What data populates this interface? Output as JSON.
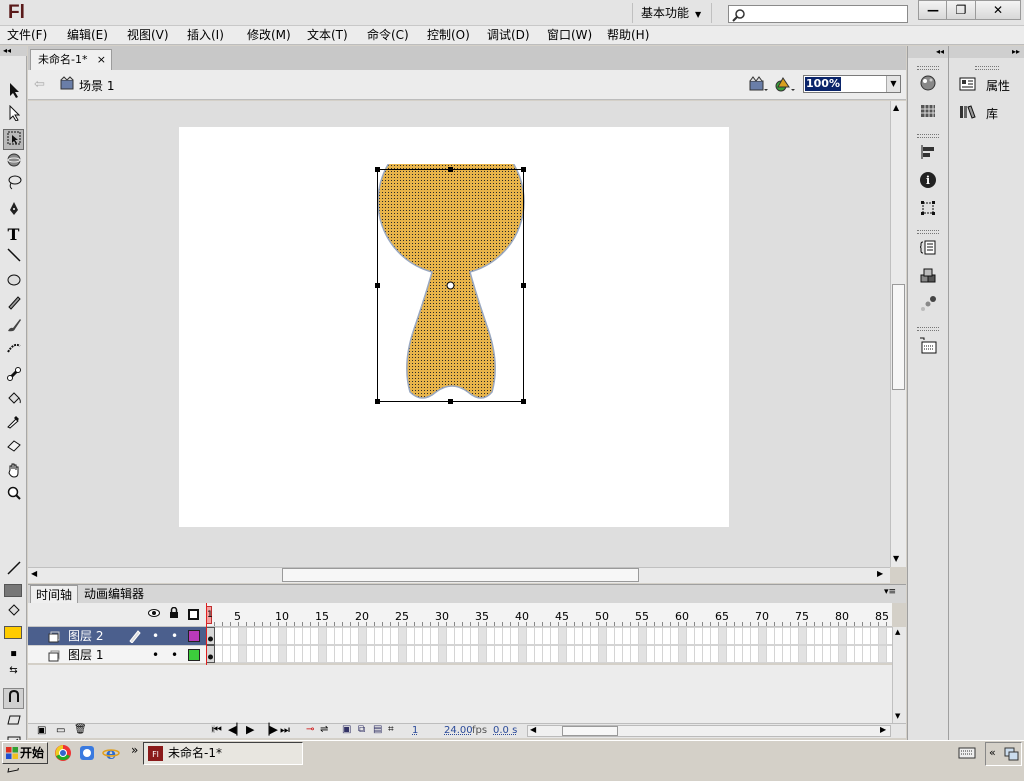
{
  "app": {
    "logo": "Fl",
    "workspace": "基本功能"
  },
  "window_controls": {
    "minimize": "—",
    "restore": "❐",
    "close": "✕"
  },
  "menubar": [
    "文件(F)",
    "编辑(E)",
    "视图(V)",
    "插入(I)",
    "修改(M)",
    "文本(T)",
    "命令(C)",
    "控制(O)",
    "调试(D)",
    "窗口(W)",
    "帮助(H)"
  ],
  "document": {
    "tab": "未命名-1*",
    "scene": "场景 1",
    "zoom": "100%"
  },
  "timeline": {
    "tabs": [
      "时间轴",
      "动画编辑器"
    ],
    "frame_numbers": [
      "1",
      "5",
      "10",
      "15",
      "20",
      "25",
      "30",
      "35",
      "40",
      "45",
      "50",
      "55",
      "60",
      "65",
      "70",
      "75",
      "80",
      "85"
    ],
    "layers": [
      {
        "name": "图层 2",
        "selected": true,
        "color": "#b93ab9"
      },
      {
        "name": "图层 1",
        "selected": false,
        "color": "#3ccc3c"
      }
    ],
    "status": {
      "current_frame": "1",
      "fps": "24.00",
      "fps_unit": "fps",
      "time": "0.0 s"
    }
  },
  "panels": {
    "properties": "属性",
    "library": "库"
  },
  "shape": {
    "fill_color": "#e8b44a",
    "outline_color": "#9aa8c0"
  },
  "tools": {
    "stroke_color": "#000000",
    "fill_color": "#ffcc00"
  },
  "taskbar": {
    "start": "开始",
    "item": "未命名-1*",
    "more": "»"
  }
}
